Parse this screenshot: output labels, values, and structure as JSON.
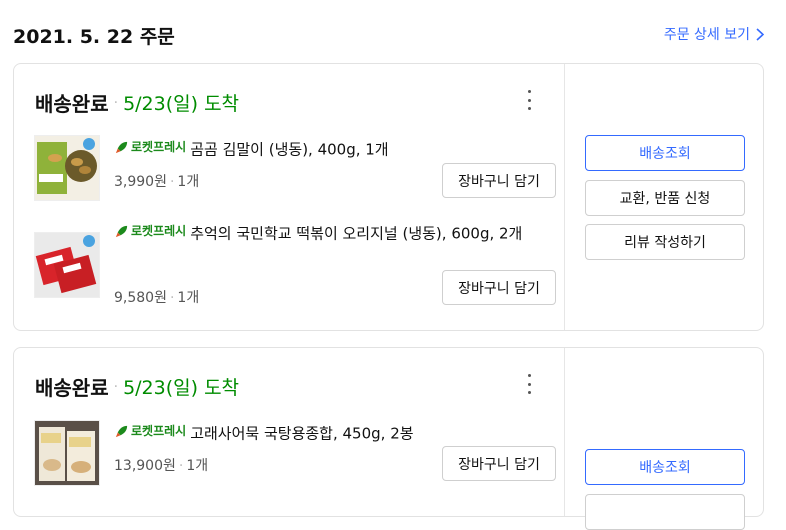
{
  "order": {
    "date_label": "2021. 5. 22 주문",
    "detail_link": "주문 상세 보기"
  },
  "shipments": [
    {
      "status": "배송완료",
      "dot": "·",
      "arrival": "5/23(일) 도착",
      "items": [
        {
          "badge": "로켓프레시",
          "name": "곰곰 김말이 (냉동), 400g, 1개",
          "price": "3,990원",
          "qty": "1개",
          "cart_label": "장바구니 담기",
          "thumb_icon": "gimmari-product-image"
        },
        {
          "badge": "로켓프레시",
          "name": "추억의 국민학교 떡볶이 오리지널 (냉동), 600g, 2개",
          "price": "9,580원",
          "qty": "1개",
          "cart_label": "장바구니 담기",
          "thumb_icon": "tteokbokki-product-image"
        }
      ],
      "actions": {
        "track": "배송조회",
        "exchange": "교환, 반품 신청",
        "review": "리뷰 작성하기"
      }
    },
    {
      "status": "배송완료",
      "dot": "·",
      "arrival": "5/23(일) 도착",
      "items": [
        {
          "badge": "로켓프레시",
          "name": "고래사어묵 국탕용종합, 450g, 2봉",
          "price": "13,900원",
          "qty": "1개",
          "cart_label": "장바구니 담기",
          "thumb_icon": "fishcake-product-image"
        }
      ],
      "actions": {
        "track": "배송조회"
      }
    }
  ],
  "colors": {
    "link_blue": "#346aff",
    "arrival_green": "#008c00",
    "rocket_green": "#1c8a1c"
  }
}
